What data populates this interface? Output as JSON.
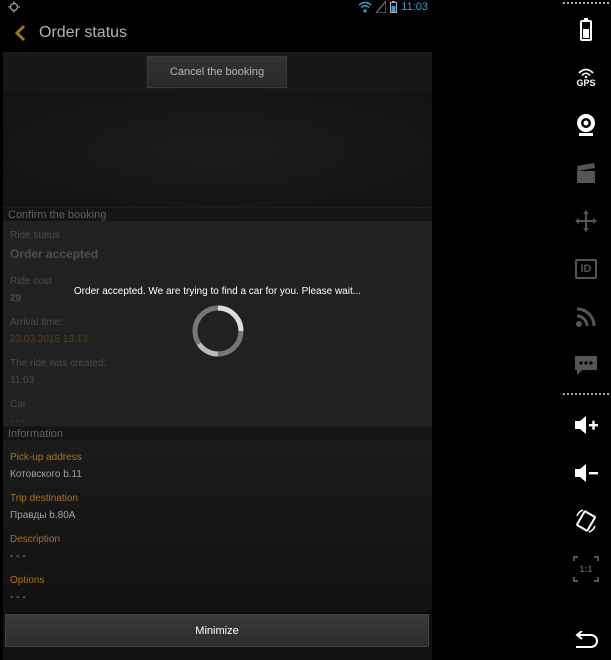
{
  "status_bar": {
    "time": "11:03"
  },
  "action_bar": {
    "title": "Order status"
  },
  "toolbar": {
    "cancel_label": "Cancel the booking"
  },
  "confirm_section": {
    "header": "Confirm the booking",
    "ride_status_label": "Ride status",
    "ride_status_value": "Order accepted",
    "ride_cost_label": "Ride cost",
    "ride_cost_value": "29",
    "arrival_label": "Arrival time:",
    "arrival_value": "23.03.2015 13:13",
    "created_label": "The ride was created:",
    "created_value": "11:03",
    "car_label": "Car",
    "car_value": "- - -"
  },
  "info_section": {
    "header": "Information",
    "pickup_label": "Pick-up address",
    "pickup_value": "Котовского b.11",
    "destination_label": "Trip destination",
    "destination_value": "Правды b.80A",
    "description_label": "Description",
    "description_value": "- - -",
    "options_label": "Options",
    "options_value": "- - -"
  },
  "minimize_label": "Minimize",
  "progress": {
    "message": "Order accepted. We are trying to find a car for you. Please wait..."
  },
  "side_panel": {
    "icons": [
      "battery-icon",
      "gps-icon",
      "camera-icon",
      "clapperboard-icon",
      "move-icon",
      "id-icon",
      "rss-icon",
      "sms-icon",
      "volume-up-icon",
      "volume-down-icon",
      "rotate-icon",
      "scale-icon",
      "back-icon"
    ],
    "gps_text": "GPS",
    "id_text": "ID",
    "scale_text": "1:1"
  },
  "colors": {
    "accent": "#f0a31f",
    "time": "#2e9fd8",
    "background": "#111111"
  }
}
